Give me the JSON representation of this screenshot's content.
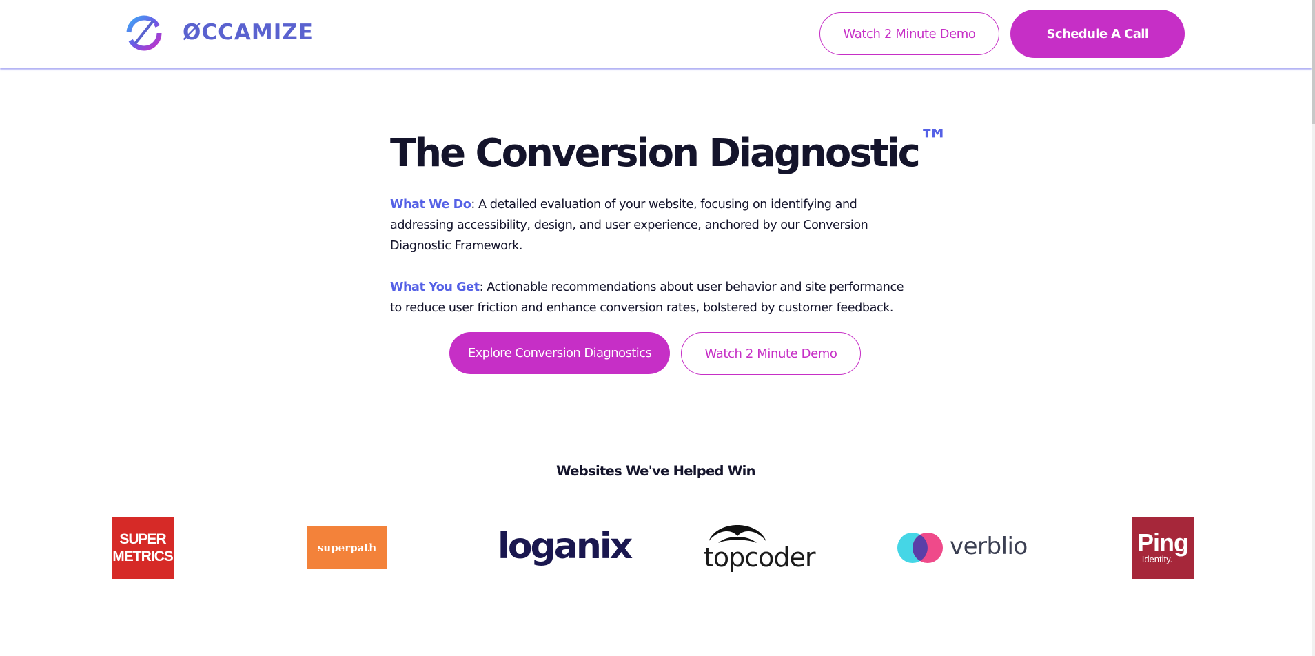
{
  "header": {
    "logo_text": "ØCCAMIZE",
    "demo_button": "Watch 2 Minute Demo",
    "call_button": "Schedule A Call"
  },
  "hero": {
    "title": "The Conversion Diagnostic",
    "tm": "™",
    "what_we_do_label": "What We Do",
    "what_we_do_text": ": A detailed evaluation of your website, focusing on identifying and addressing accessibility, design, and user experience, anchored by our Conversion Diagnostic Framework.",
    "what_you_get_label": "What You Get",
    "what_you_get_text": ": Actionable recommendations about user behavior and site performance to reduce user friction and enhance conversion rates, bolstered by customer feedback.",
    "explore_button": "Explore Conversion Diagnostics",
    "demo_button": "Watch 2 Minute Demo"
  },
  "clients": {
    "title": "Websites We've Helped Win",
    "logos": [
      {
        "name": "supermetrics",
        "line1": "SUPER",
        "line2": "METRICS"
      },
      {
        "name": "superpath",
        "text": "superpath"
      },
      {
        "name": "loganix",
        "text": "loganix"
      },
      {
        "name": "topcoder",
        "text": "topcoder"
      },
      {
        "name": "verblio",
        "text": "verblio"
      },
      {
        "name": "ping-identity",
        "line1": "Ping",
        "line2": "Identity."
      }
    ]
  },
  "colors": {
    "accent": "#c62fc6",
    "brand_blue": "#5561e6",
    "text_dark": "#14142b"
  }
}
